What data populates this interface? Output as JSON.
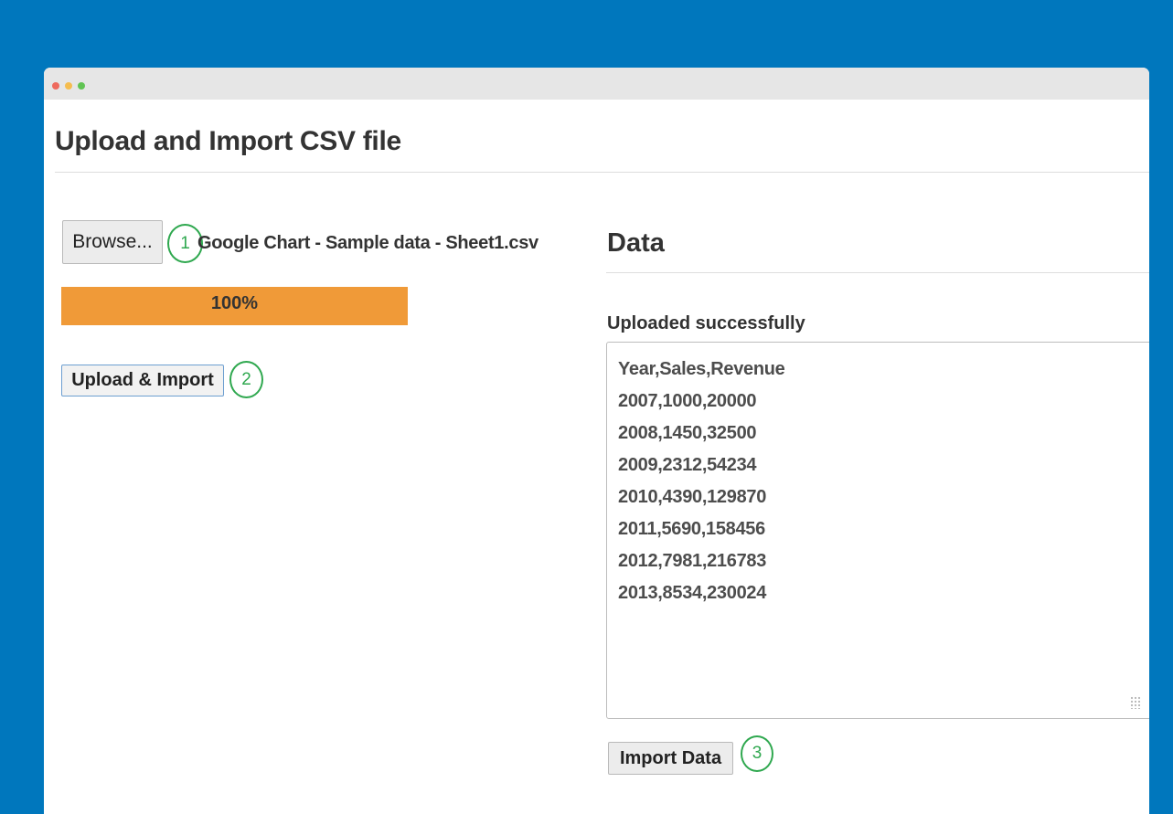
{
  "page": {
    "title": "Upload and Import CSV file",
    "background_color": "#0077bd"
  },
  "file_input": {
    "browse_label": "Browse...",
    "file_name": "Google Chart - Sample data - Sheet1.csv"
  },
  "progress": {
    "label": "100%",
    "fraction": 1.0,
    "color": "#f09a38"
  },
  "actions": {
    "upload_import_label": "Upload & Import",
    "import_data_label": "Import Data"
  },
  "steps": [
    "1",
    "2",
    "3"
  ],
  "data_panel": {
    "heading": "Data",
    "status": "Uploaded successfully",
    "lines": [
      "Year,Sales,Revenue",
      "2007,1000,20000",
      "2008,1450,32500",
      "2009,2312,54234",
      "2010,4390,129870",
      "2011,5690,158456",
      "2012,7981,216783",
      "2013,8534,230024"
    ]
  }
}
